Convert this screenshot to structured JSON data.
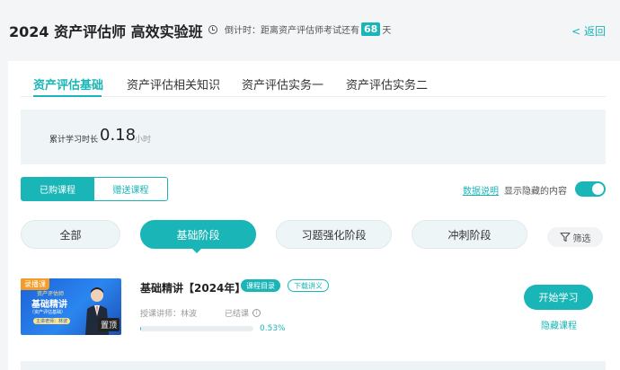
{
  "header": {
    "title": "2024 资产评估师 高效实验班",
    "countdown_prefix": "倒计时：距离资产评估师考试还有",
    "countdown_days": "68",
    "countdown_suffix": "天",
    "back_label": "< 返回"
  },
  "tabs": [
    {
      "label": "资产评估基础",
      "active": true
    },
    {
      "label": "资产评估相关知识",
      "active": false
    },
    {
      "label": "资产评估实务一",
      "active": false
    },
    {
      "label": "资产评估实务二",
      "active": false
    }
  ],
  "study": {
    "label": "累计学习时长",
    "value": "0.18",
    "unit": "小时"
  },
  "course_filter": {
    "purchased": "已购课程",
    "gifted": "赠送课程"
  },
  "options": {
    "data_note": "数据说明",
    "show_hidden": "显示隐藏的内容",
    "show_hidden_on": true
  },
  "stages": [
    {
      "label": "全部",
      "active": false
    },
    {
      "label": "基础阶段",
      "active": true
    },
    {
      "label": "习题强化阶段",
      "active": false
    },
    {
      "label": "冲刺阶段",
      "active": false
    }
  ],
  "filter_label": "筛选",
  "course": {
    "thumb": {
      "tag": "录播课",
      "subtitle": "资产评估师",
      "title": "基础精讲",
      "desc": "（资产评估基础）",
      "teacher_pill": "主讲老师：林波",
      "pin_label": "置顶"
    },
    "name": "基础精讲【2024年】",
    "chip_catalog": "课程目录",
    "chip_notes": "下载讲义",
    "instructor": "授课讲师：林波",
    "status": "已结课",
    "progress_percent": 0.53,
    "progress_text": "0.53%",
    "start_label": "开始学习",
    "hide_label": "隐藏课程"
  },
  "colors": {
    "accent": "#1ab5b6",
    "thumb_blue": "#2b86f0",
    "tag_orange": "#f29d2a"
  }
}
